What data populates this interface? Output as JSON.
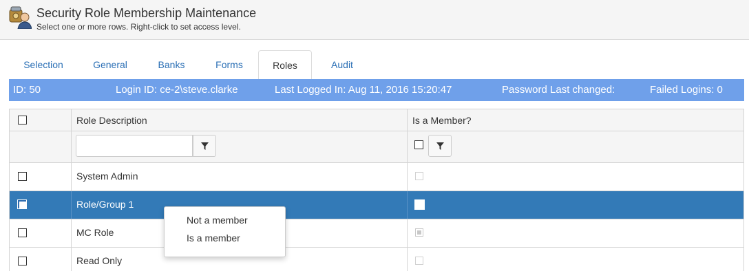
{
  "header": {
    "title": "Security Role Membership Maintenance",
    "subtitle": "Select one or more rows. Right-click to set access level.",
    "icon": "user-lock-icon"
  },
  "tabs": [
    {
      "label": "Selection",
      "active": false
    },
    {
      "label": "General",
      "active": false
    },
    {
      "label": "Banks",
      "active": false
    },
    {
      "label": "Forms",
      "active": false
    },
    {
      "label": "Roles",
      "active": true
    },
    {
      "label": "Audit",
      "active": false
    }
  ],
  "infobar": {
    "id": "ID: 50",
    "login": "Login ID: ce-2\\steve.clarke",
    "last_logged": "Last Logged In: Aug 11, 2016 15:20:47",
    "password_changed": "Password Last changed:",
    "failed_logins": "Failed Logins: 0",
    "color": "#6fa0ea"
  },
  "grid": {
    "columns": [
      "",
      "Role Description",
      "Is a Member?"
    ],
    "filter": {
      "role_value": "",
      "member_checked": false
    },
    "rows": [
      {
        "description": "System Admin",
        "selected": false,
        "member": false
      },
      {
        "description": "Role/Group 1",
        "selected": true,
        "member": false
      },
      {
        "description": "MC Role",
        "selected": false,
        "member": true
      },
      {
        "description": "Read Only",
        "selected": false,
        "member": false
      }
    ],
    "selected_color": "#337ab7"
  },
  "context_menu": {
    "items": [
      "Not a member",
      "Is a member"
    ]
  }
}
